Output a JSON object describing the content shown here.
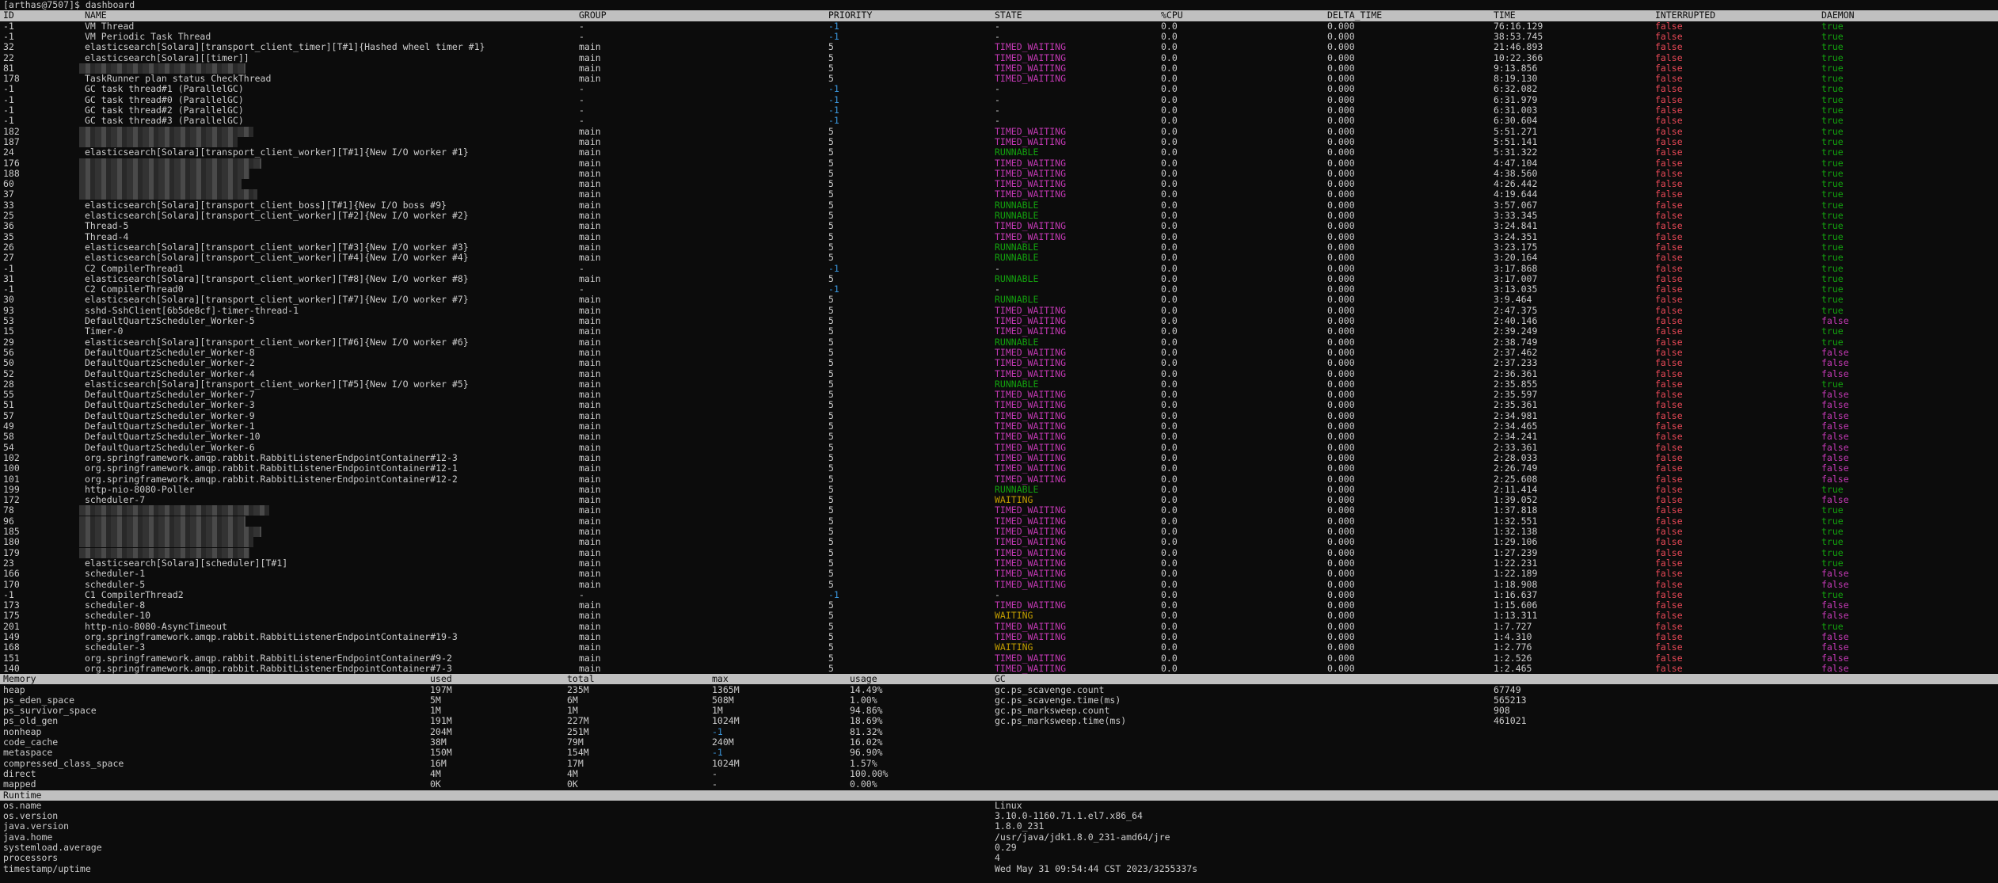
{
  "prompt": "[arthas@7507]$ dashboard",
  "thread_headers": [
    "ID",
    "NAME",
    "GROUP",
    "PRIORITY",
    "STATE",
    "%CPU",
    "DELTA_TIME",
    "TIME",
    "INTERRUPTED",
    "DAEMON"
  ],
  "threads": [
    [
      "-1",
      "VM Thread",
      "-",
      "-1",
      "-",
      "0.0",
      "0.000",
      "76:16.129",
      "false",
      "true"
    ],
    [
      "-1",
      "VM Periodic Task Thread",
      "-",
      "-1",
      "-",
      "0.0",
      "0.000",
      "38:53.745",
      "false",
      "true"
    ],
    [
      "32",
      "elasticsearch[Solara][transport_client_timer][T#1]{Hashed wheel timer #1}",
      "main",
      "5",
      "TIMED_WAITING",
      "0.0",
      "0.000",
      "21:46.893",
      "false",
      "true"
    ],
    [
      "22",
      "elasticsearch[Solara][[timer]]",
      "main",
      "5",
      "TIMED_WAITING",
      "0.0",
      "0.000",
      "10:22.366",
      "false",
      "true"
    ],
    [
      "81",
      "",
      "main",
      "5",
      "TIMED_WAITING",
      "0.0",
      "0.000",
      "9:13.856",
      "false",
      "true"
    ],
    [
      "178",
      "TaskRunner plan status CheckThread",
      "main",
      "5",
      "TIMED_WAITING",
      "0.0",
      "0.000",
      "8:19.130",
      "false",
      "true"
    ],
    [
      "-1",
      "GC task thread#1 (ParallelGC)",
      "-",
      "-1",
      "-",
      "0.0",
      "0.000",
      "6:32.082",
      "false",
      "true"
    ],
    [
      "-1",
      "GC task thread#0 (ParallelGC)",
      "-",
      "-1",
      "-",
      "0.0",
      "0.000",
      "6:31.979",
      "false",
      "true"
    ],
    [
      "-1",
      "GC task thread#2 (ParallelGC)",
      "-",
      "-1",
      "-",
      "0.0",
      "0.000",
      "6:31.003",
      "false",
      "true"
    ],
    [
      "-1",
      "GC task thread#3 (ParallelGC)",
      "-",
      "-1",
      "-",
      "0.0",
      "0.000",
      "6:30.604",
      "false",
      "true"
    ],
    [
      "182",
      "",
      "main",
      "5",
      "TIMED_WAITING",
      "0.0",
      "0.000",
      "5:51.271",
      "false",
      "true"
    ],
    [
      "187",
      "",
      "main",
      "5",
      "TIMED_WAITING",
      "0.0",
      "0.000",
      "5:51.141",
      "false",
      "true"
    ],
    [
      "24",
      "elasticsearch[Solara][transport_client_worker][T#1]{New I/O worker #1}",
      "main",
      "5",
      "RUNNABLE",
      "0.0",
      "0.000",
      "5:31.322",
      "false",
      "true"
    ],
    [
      "176",
      "",
      "main",
      "5",
      "TIMED_WAITING",
      "0.0",
      "0.000",
      "4:47.104",
      "false",
      "true"
    ],
    [
      "188",
      "",
      "main",
      "5",
      "TIMED_WAITING",
      "0.0",
      "0.000",
      "4:38.560",
      "false",
      "true"
    ],
    [
      "60",
      "",
      "main",
      "5",
      "TIMED_WAITING",
      "0.0",
      "0.000",
      "4:26.442",
      "false",
      "true"
    ],
    [
      "37",
      "",
      "main",
      "5",
      "TIMED_WAITING",
      "0.0",
      "0.000",
      "4:19.644",
      "false",
      "true"
    ],
    [
      "33",
      "elasticsearch[Solara][transport_client_boss][T#1]{New I/O boss #9}",
      "main",
      "5",
      "RUNNABLE",
      "0.0",
      "0.000",
      "3:57.067",
      "false",
      "true"
    ],
    [
      "25",
      "elasticsearch[Solara][transport_client_worker][T#2]{New I/O worker #2}",
      "main",
      "5",
      "RUNNABLE",
      "0.0",
      "0.000",
      "3:33.345",
      "false",
      "true"
    ],
    [
      "36",
      "Thread-5",
      "main",
      "5",
      "TIMED_WAITING",
      "0.0",
      "0.000",
      "3:24.841",
      "false",
      "true"
    ],
    [
      "35",
      "Thread-4",
      "main",
      "5",
      "TIMED_WAITING",
      "0.0",
      "0.000",
      "3:24.351",
      "false",
      "true"
    ],
    [
      "26",
      "elasticsearch[Solara][transport_client_worker][T#3]{New I/O worker #3}",
      "main",
      "5",
      "RUNNABLE",
      "0.0",
      "0.000",
      "3:23.175",
      "false",
      "true"
    ],
    [
      "27",
      "elasticsearch[Solara][transport_client_worker][T#4]{New I/O worker #4}",
      "main",
      "5",
      "RUNNABLE",
      "0.0",
      "0.000",
      "3:20.164",
      "false",
      "true"
    ],
    [
      "-1",
      "C2 CompilerThread1",
      "-",
      "-1",
      "-",
      "0.0",
      "0.000",
      "3:17.868",
      "false",
      "true"
    ],
    [
      "31",
      "elasticsearch[Solara][transport_client_worker][T#8]{New I/O worker #8}",
      "main",
      "5",
      "RUNNABLE",
      "0.0",
      "0.000",
      "3:17.007",
      "false",
      "true"
    ],
    [
      "-1",
      "C2 CompilerThread0",
      "-",
      "-1",
      "-",
      "0.0",
      "0.000",
      "3:13.035",
      "false",
      "true"
    ],
    [
      "30",
      "elasticsearch[Solara][transport_client_worker][T#7]{New I/O worker #7}",
      "main",
      "5",
      "RUNNABLE",
      "0.0",
      "0.000",
      "3:9.464",
      "false",
      "true"
    ],
    [
      "93",
      "sshd-SshClient[6b5de8cf]-timer-thread-1",
      "main",
      "5",
      "TIMED_WAITING",
      "0.0",
      "0.000",
      "2:47.375",
      "false",
      "true"
    ],
    [
      "53",
      "DefaultQuartzScheduler_Worker-5",
      "main",
      "5",
      "TIMED_WAITING",
      "0.0",
      "0.000",
      "2:40.146",
      "false",
      "false"
    ],
    [
      "15",
      "Timer-0",
      "main",
      "5",
      "TIMED_WAITING",
      "0.0",
      "0.000",
      "2:39.249",
      "false",
      "true"
    ],
    [
      "29",
      "elasticsearch[Solara][transport_client_worker][T#6]{New I/O worker #6}",
      "main",
      "5",
      "RUNNABLE",
      "0.0",
      "0.000",
      "2:38.749",
      "false",
      "true"
    ],
    [
      "56",
      "DefaultQuartzScheduler_Worker-8",
      "main",
      "5",
      "TIMED_WAITING",
      "0.0",
      "0.000",
      "2:37.462",
      "false",
      "false"
    ],
    [
      "50",
      "DefaultQuartzScheduler_Worker-2",
      "main",
      "5",
      "TIMED_WAITING",
      "0.0",
      "0.000",
      "2:37.233",
      "false",
      "false"
    ],
    [
      "52",
      "DefaultQuartzScheduler_Worker-4",
      "main",
      "5",
      "TIMED_WAITING",
      "0.0",
      "0.000",
      "2:36.361",
      "false",
      "false"
    ],
    [
      "28",
      "elasticsearch[Solara][transport_client_worker][T#5]{New I/O worker #5}",
      "main",
      "5",
      "RUNNABLE",
      "0.0",
      "0.000",
      "2:35.855",
      "false",
      "true"
    ],
    [
      "55",
      "DefaultQuartzScheduler_Worker-7",
      "main",
      "5",
      "TIMED_WAITING",
      "0.0",
      "0.000",
      "2:35.597",
      "false",
      "false"
    ],
    [
      "51",
      "DefaultQuartzScheduler_Worker-3",
      "main",
      "5",
      "TIMED_WAITING",
      "0.0",
      "0.000",
      "2:35.361",
      "false",
      "false"
    ],
    [
      "57",
      "DefaultQuartzScheduler_Worker-9",
      "main",
      "5",
      "TIMED_WAITING",
      "0.0",
      "0.000",
      "2:34.981",
      "false",
      "false"
    ],
    [
      "49",
      "DefaultQuartzScheduler_Worker-1",
      "main",
      "5",
      "TIMED_WAITING",
      "0.0",
      "0.000",
      "2:34.465",
      "false",
      "false"
    ],
    [
      "58",
      "DefaultQuartzScheduler_Worker-10",
      "main",
      "5",
      "TIMED_WAITING",
      "0.0",
      "0.000",
      "2:34.241",
      "false",
      "false"
    ],
    [
      "54",
      "DefaultQuartzScheduler_Worker-6",
      "main",
      "5",
      "TIMED_WAITING",
      "0.0",
      "0.000",
      "2:33.361",
      "false",
      "false"
    ],
    [
      "102",
      "org.springframework.amqp.rabbit.RabbitListenerEndpointContainer#12-3",
      "main",
      "5",
      "TIMED_WAITING",
      "0.0",
      "0.000",
      "2:28.033",
      "false",
      "false"
    ],
    [
      "100",
      "org.springframework.amqp.rabbit.RabbitListenerEndpointContainer#12-1",
      "main",
      "5",
      "TIMED_WAITING",
      "0.0",
      "0.000",
      "2:26.749",
      "false",
      "false"
    ],
    [
      "101",
      "org.springframework.amqp.rabbit.RabbitListenerEndpointContainer#12-2",
      "main",
      "5",
      "TIMED_WAITING",
      "0.0",
      "0.000",
      "2:25.608",
      "false",
      "false"
    ],
    [
      "199",
      "http-nio-8080-Poller",
      "main",
      "5",
      "RUNNABLE",
      "0.0",
      "0.000",
      "2:11.414",
      "false",
      "true"
    ],
    [
      "172",
      "scheduler-7",
      "main",
      "5",
      "WAITING",
      "0.0",
      "0.000",
      "1:39.052",
      "false",
      "false"
    ],
    [
      "78",
      "",
      "main",
      "5",
      "TIMED_WAITING",
      "0.0",
      "0.000",
      "1:37.818",
      "false",
      "true"
    ],
    [
      "96",
      "",
      "main",
      "5",
      "TIMED_WAITING",
      "0.0",
      "0.000",
      "1:32.551",
      "false",
      "true"
    ],
    [
      "185",
      "",
      "main",
      "5",
      "TIMED_WAITING",
      "0.0",
      "0.000",
      "1:32.138",
      "false",
      "true"
    ],
    [
      "180",
      "",
      "main",
      "5",
      "TIMED_WAITING",
      "0.0",
      "0.000",
      "1:29.106",
      "false",
      "true"
    ],
    [
      "179",
      "",
      "main",
      "5",
      "TIMED_WAITING",
      "0.0",
      "0.000",
      "1:27.239",
      "false",
      "true"
    ],
    [
      "23",
      "elasticsearch[Solara][scheduler][T#1]",
      "main",
      "5",
      "TIMED_WAITING",
      "0.0",
      "0.000",
      "1:22.231",
      "false",
      "true"
    ],
    [
      "166",
      "scheduler-1",
      "main",
      "5",
      "TIMED_WAITING",
      "0.0",
      "0.000",
      "1:22.189",
      "false",
      "false"
    ],
    [
      "170",
      "scheduler-5",
      "main",
      "5",
      "TIMED_WAITING",
      "0.0",
      "0.000",
      "1:18.908",
      "false",
      "false"
    ],
    [
      "-1",
      "C1 CompilerThread2",
      "-",
      "-1",
      "-",
      "0.0",
      "0.000",
      "1:16.637",
      "false",
      "true"
    ],
    [
      "173",
      "scheduler-8",
      "main",
      "5",
      "TIMED_WAITING",
      "0.0",
      "0.000",
      "1:15.606",
      "false",
      "false"
    ],
    [
      "175",
      "scheduler-10",
      "main",
      "5",
      "WAITING",
      "0.0",
      "0.000",
      "1:13.311",
      "false",
      "false"
    ],
    [
      "201",
      "http-nio-8080-AsyncTimeout",
      "main",
      "5",
      "TIMED_WAITING",
      "0.0",
      "0.000",
      "1:7.727",
      "false",
      "true"
    ],
    [
      "149",
      "org.springframework.amqp.rabbit.RabbitListenerEndpointContainer#19-3",
      "main",
      "5",
      "TIMED_WAITING",
      "0.0",
      "0.000",
      "1:4.310",
      "false",
      "false"
    ],
    [
      "168",
      "scheduler-3",
      "main",
      "5",
      "WAITING",
      "0.0",
      "0.000",
      "1:2.776",
      "false",
      "false"
    ],
    [
      "151",
      "org.springframework.amqp.rabbit.RabbitListenerEndpointContainer#9-2",
      "main",
      "5",
      "TIMED_WAITING",
      "0.0",
      "0.000",
      "1:2.526",
      "false",
      "false"
    ],
    [
      "140",
      "org.springframework.amqp.rabbit.RabbitListenerEndpointContainer#7-3",
      "main",
      "5",
      "TIMED_WAITING",
      "0.0",
      "0.000",
      "1:2.465",
      "false",
      "false"
    ]
  ],
  "memory_headers": [
    "Memory",
    "used",
    "total",
    "max",
    "usage",
    "GC"
  ],
  "memory": [
    [
      "heap",
      "197M",
      "235M",
      "1365M",
      "14.49%"
    ],
    [
      "ps_eden_space",
      "5M",
      "6M",
      "508M",
      "1.00%"
    ],
    [
      "ps_survivor_space",
      "1M",
      "1M",
      "1M",
      "94.86%"
    ],
    [
      "ps_old_gen",
      "191M",
      "227M",
      "1024M",
      "18.69%"
    ],
    [
      "nonheap",
      "204M",
      "251M",
      "-1",
      "81.32%"
    ],
    [
      "code_cache",
      "38M",
      "79M",
      "240M",
      "16.02%"
    ],
    [
      "metaspace",
      "150M",
      "154M",
      "-1",
      "96.90%"
    ],
    [
      "compressed_class_space",
      "16M",
      "17M",
      "1024M",
      "1.57%"
    ],
    [
      "direct",
      "4M",
      "4M",
      "-",
      "100.00%"
    ],
    [
      "mapped",
      "0K",
      "0K",
      "-",
      "0.00%"
    ]
  ],
  "gc": [
    [
      "gc.ps_scavenge.count",
      "67749"
    ],
    [
      "gc.ps_scavenge.time(ms)",
      "565213"
    ],
    [
      "gc.ps_marksweep.count",
      "908"
    ],
    [
      "gc.ps_marksweep.time(ms)",
      "461021"
    ]
  ],
  "runtime_header": "Runtime",
  "runtime": [
    [
      "os.name",
      "Linux"
    ],
    [
      "os.version",
      "3.10.0-1160.71.1.el7.x86_64"
    ],
    [
      "java.version",
      "1.8.0_231"
    ],
    [
      "java.home",
      "/usr/java/jdk1.8.0_231-amd64/jre"
    ],
    [
      "systemload.average",
      "0.29"
    ],
    [
      "processors",
      "4"
    ],
    [
      "timestamp/uptime",
      "Wed May 31 09:54:44 CST 2023/3255337s"
    ]
  ],
  "colors": {
    "background": "#0c0c0c",
    "text": "#cccccc",
    "header_bar": "#c0c0c0",
    "priority_negative": "#3a96dd",
    "runnable": "#13a10e",
    "timed_waiting": "#c239b3",
    "waiting": "#c19c00",
    "false_value": "#e74856",
    "daemon_true": "#13a10e",
    "daemon_false": "#c239b3"
  }
}
